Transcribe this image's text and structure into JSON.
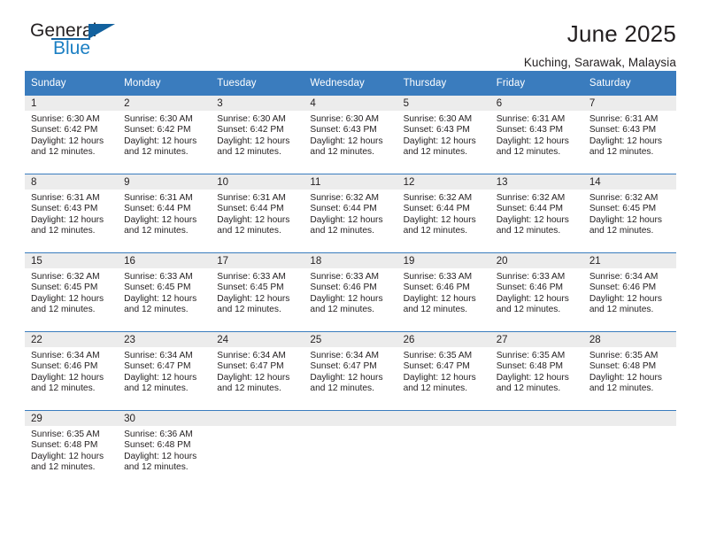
{
  "brand": {
    "word_general": "General",
    "word_blue": "Blue",
    "triangle_color": "#12619e",
    "blue_text_color": "#1b7fc3"
  },
  "header": {
    "title": "June 2025",
    "subtitle": "Kuching, Sarawak, Malaysia"
  },
  "theme": {
    "header_blue": "#3a7cbe",
    "daynum_gray": "#ececec",
    "text_color": "#231f20"
  },
  "calendar": {
    "weekday_headers": [
      "Sunday",
      "Monday",
      "Tuesday",
      "Wednesday",
      "Thursday",
      "Friday",
      "Saturday"
    ],
    "labels": {
      "sunrise": "Sunrise:",
      "sunset": "Sunset:",
      "daylight": "Daylight:"
    },
    "weeks": [
      [
        {
          "day": "1",
          "sunrise": "Sunrise: 6:30 AM",
          "sunset": "Sunset: 6:42 PM",
          "daylight_l1": "Daylight: 12 hours",
          "daylight_l2": "and 12 minutes."
        },
        {
          "day": "2",
          "sunrise": "Sunrise: 6:30 AM",
          "sunset": "Sunset: 6:42 PM",
          "daylight_l1": "Daylight: 12 hours",
          "daylight_l2": "and 12 minutes."
        },
        {
          "day": "3",
          "sunrise": "Sunrise: 6:30 AM",
          "sunset": "Sunset: 6:42 PM",
          "daylight_l1": "Daylight: 12 hours",
          "daylight_l2": "and 12 minutes."
        },
        {
          "day": "4",
          "sunrise": "Sunrise: 6:30 AM",
          "sunset": "Sunset: 6:43 PM",
          "daylight_l1": "Daylight: 12 hours",
          "daylight_l2": "and 12 minutes."
        },
        {
          "day": "5",
          "sunrise": "Sunrise: 6:30 AM",
          "sunset": "Sunset: 6:43 PM",
          "daylight_l1": "Daylight: 12 hours",
          "daylight_l2": "and 12 minutes."
        },
        {
          "day": "6",
          "sunrise": "Sunrise: 6:31 AM",
          "sunset": "Sunset: 6:43 PM",
          "daylight_l1": "Daylight: 12 hours",
          "daylight_l2": "and 12 minutes."
        },
        {
          "day": "7",
          "sunrise": "Sunrise: 6:31 AM",
          "sunset": "Sunset: 6:43 PM",
          "daylight_l1": "Daylight: 12 hours",
          "daylight_l2": "and 12 minutes."
        }
      ],
      [
        {
          "day": "8",
          "sunrise": "Sunrise: 6:31 AM",
          "sunset": "Sunset: 6:43 PM",
          "daylight_l1": "Daylight: 12 hours",
          "daylight_l2": "and 12 minutes."
        },
        {
          "day": "9",
          "sunrise": "Sunrise: 6:31 AM",
          "sunset": "Sunset: 6:44 PM",
          "daylight_l1": "Daylight: 12 hours",
          "daylight_l2": "and 12 minutes."
        },
        {
          "day": "10",
          "sunrise": "Sunrise: 6:31 AM",
          "sunset": "Sunset: 6:44 PM",
          "daylight_l1": "Daylight: 12 hours",
          "daylight_l2": "and 12 minutes."
        },
        {
          "day": "11",
          "sunrise": "Sunrise: 6:32 AM",
          "sunset": "Sunset: 6:44 PM",
          "daylight_l1": "Daylight: 12 hours",
          "daylight_l2": "and 12 minutes."
        },
        {
          "day": "12",
          "sunrise": "Sunrise: 6:32 AM",
          "sunset": "Sunset: 6:44 PM",
          "daylight_l1": "Daylight: 12 hours",
          "daylight_l2": "and 12 minutes."
        },
        {
          "day": "13",
          "sunrise": "Sunrise: 6:32 AM",
          "sunset": "Sunset: 6:44 PM",
          "daylight_l1": "Daylight: 12 hours",
          "daylight_l2": "and 12 minutes."
        },
        {
          "day": "14",
          "sunrise": "Sunrise: 6:32 AM",
          "sunset": "Sunset: 6:45 PM",
          "daylight_l1": "Daylight: 12 hours",
          "daylight_l2": "and 12 minutes."
        }
      ],
      [
        {
          "day": "15",
          "sunrise": "Sunrise: 6:32 AM",
          "sunset": "Sunset: 6:45 PM",
          "daylight_l1": "Daylight: 12 hours",
          "daylight_l2": "and 12 minutes."
        },
        {
          "day": "16",
          "sunrise": "Sunrise: 6:33 AM",
          "sunset": "Sunset: 6:45 PM",
          "daylight_l1": "Daylight: 12 hours",
          "daylight_l2": "and 12 minutes."
        },
        {
          "day": "17",
          "sunrise": "Sunrise: 6:33 AM",
          "sunset": "Sunset: 6:45 PM",
          "daylight_l1": "Daylight: 12 hours",
          "daylight_l2": "and 12 minutes."
        },
        {
          "day": "18",
          "sunrise": "Sunrise: 6:33 AM",
          "sunset": "Sunset: 6:46 PM",
          "daylight_l1": "Daylight: 12 hours",
          "daylight_l2": "and 12 minutes."
        },
        {
          "day": "19",
          "sunrise": "Sunrise: 6:33 AM",
          "sunset": "Sunset: 6:46 PM",
          "daylight_l1": "Daylight: 12 hours",
          "daylight_l2": "and 12 minutes."
        },
        {
          "day": "20",
          "sunrise": "Sunrise: 6:33 AM",
          "sunset": "Sunset: 6:46 PM",
          "daylight_l1": "Daylight: 12 hours",
          "daylight_l2": "and 12 minutes."
        },
        {
          "day": "21",
          "sunrise": "Sunrise: 6:34 AM",
          "sunset": "Sunset: 6:46 PM",
          "daylight_l1": "Daylight: 12 hours",
          "daylight_l2": "and 12 minutes."
        }
      ],
      [
        {
          "day": "22",
          "sunrise": "Sunrise: 6:34 AM",
          "sunset": "Sunset: 6:46 PM",
          "daylight_l1": "Daylight: 12 hours",
          "daylight_l2": "and 12 minutes."
        },
        {
          "day": "23",
          "sunrise": "Sunrise: 6:34 AM",
          "sunset": "Sunset: 6:47 PM",
          "daylight_l1": "Daylight: 12 hours",
          "daylight_l2": "and 12 minutes."
        },
        {
          "day": "24",
          "sunrise": "Sunrise: 6:34 AM",
          "sunset": "Sunset: 6:47 PM",
          "daylight_l1": "Daylight: 12 hours",
          "daylight_l2": "and 12 minutes."
        },
        {
          "day": "25",
          "sunrise": "Sunrise: 6:34 AM",
          "sunset": "Sunset: 6:47 PM",
          "daylight_l1": "Daylight: 12 hours",
          "daylight_l2": "and 12 minutes."
        },
        {
          "day": "26",
          "sunrise": "Sunrise: 6:35 AM",
          "sunset": "Sunset: 6:47 PM",
          "daylight_l1": "Daylight: 12 hours",
          "daylight_l2": "and 12 minutes."
        },
        {
          "day": "27",
          "sunrise": "Sunrise: 6:35 AM",
          "sunset": "Sunset: 6:48 PM",
          "daylight_l1": "Daylight: 12 hours",
          "daylight_l2": "and 12 minutes."
        },
        {
          "day": "28",
          "sunrise": "Sunrise: 6:35 AM",
          "sunset": "Sunset: 6:48 PM",
          "daylight_l1": "Daylight: 12 hours",
          "daylight_l2": "and 12 minutes."
        }
      ],
      [
        {
          "day": "29",
          "sunrise": "Sunrise: 6:35 AM",
          "sunset": "Sunset: 6:48 PM",
          "daylight_l1": "Daylight: 12 hours",
          "daylight_l2": "and 12 minutes."
        },
        {
          "day": "30",
          "sunrise": "Sunrise: 6:36 AM",
          "sunset": "Sunset: 6:48 PM",
          "daylight_l1": "Daylight: 12 hours",
          "daylight_l2": "and 12 minutes."
        },
        {
          "day": "",
          "sunrise": "",
          "sunset": "",
          "daylight_l1": "",
          "daylight_l2": ""
        },
        {
          "day": "",
          "sunrise": "",
          "sunset": "",
          "daylight_l1": "",
          "daylight_l2": ""
        },
        {
          "day": "",
          "sunrise": "",
          "sunset": "",
          "daylight_l1": "",
          "daylight_l2": ""
        },
        {
          "day": "",
          "sunrise": "",
          "sunset": "",
          "daylight_l1": "",
          "daylight_l2": ""
        },
        {
          "day": "",
          "sunrise": "",
          "sunset": "",
          "daylight_l1": "",
          "daylight_l2": ""
        }
      ]
    ]
  }
}
